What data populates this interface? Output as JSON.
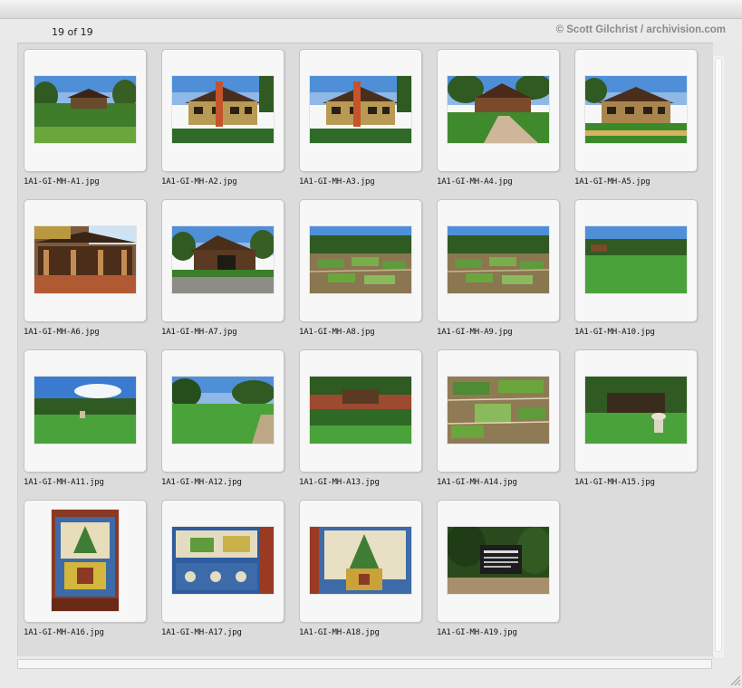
{
  "header": {
    "count_text": "19 of 19",
    "copyright_text": "© Scott Gilchrist / archivision.com"
  },
  "thumbnails": [
    {
      "filename": "1A1-GI-MH-A1.jpg",
      "kind": "landscape",
      "scene": "house-garden-wide"
    },
    {
      "filename": "1A1-GI-MH-A2.jpg",
      "kind": "landscape",
      "scene": "house-chimney"
    },
    {
      "filename": "1A1-GI-MH-A3.jpg",
      "kind": "landscape",
      "scene": "house-chimney"
    },
    {
      "filename": "1A1-GI-MH-A4.jpg",
      "kind": "landscape",
      "scene": "house-path"
    },
    {
      "filename": "1A1-GI-MH-A5.jpg",
      "kind": "landscape",
      "scene": "house-garden"
    },
    {
      "filename": "1A1-GI-MH-A6.jpg",
      "kind": "landscape",
      "scene": "porch"
    },
    {
      "filename": "1A1-GI-MH-A7.jpg",
      "kind": "landscape",
      "scene": "garage"
    },
    {
      "filename": "1A1-GI-MH-A8.jpg",
      "kind": "landscape",
      "scene": "garden-beds"
    },
    {
      "filename": "1A1-GI-MH-A9.jpg",
      "kind": "landscape",
      "scene": "garden-beds"
    },
    {
      "filename": "1A1-GI-MH-A10.jpg",
      "kind": "landscape",
      "scene": "lawn"
    },
    {
      "filename": "1A1-GI-MH-A11.jpg",
      "kind": "landscape",
      "scene": "lawn-sky"
    },
    {
      "filename": "1A1-GI-MH-A12.jpg",
      "kind": "landscape",
      "scene": "lawn-trees"
    },
    {
      "filename": "1A1-GI-MH-A13.jpg",
      "kind": "landscape",
      "scene": "wall-garden"
    },
    {
      "filename": "1A1-GI-MH-A14.jpg",
      "kind": "landscape",
      "scene": "garden-closeup"
    },
    {
      "filename": "1A1-GI-MH-A15.jpg",
      "kind": "landscape",
      "scene": "lawn-urn"
    },
    {
      "filename": "1A1-GI-MH-A16.jpg",
      "kind": "portrait",
      "scene": "tile-panel"
    },
    {
      "filename": "1A1-GI-MH-A17.jpg",
      "kind": "landscape",
      "scene": "tiles"
    },
    {
      "filename": "1A1-GI-MH-A18.jpg",
      "kind": "landscape",
      "scene": "tile-panel-wide"
    },
    {
      "filename": "1A1-GI-MH-A19.jpg",
      "kind": "landscape",
      "scene": "sign"
    }
  ]
}
